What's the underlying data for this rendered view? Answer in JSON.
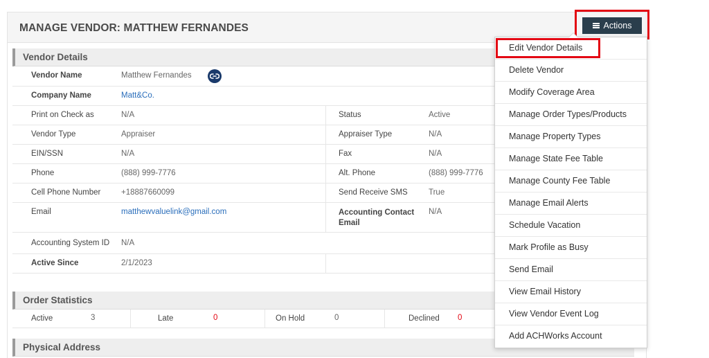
{
  "header": {
    "title": "MANAGE VENDOR: MATTHEW FERNANDES",
    "actions_label": "Actions"
  },
  "vendor_details": {
    "title": "Vendor Details",
    "rows": {
      "vendor_name": {
        "label": "Vendor Name",
        "value": "Matthew Fernandes"
      },
      "company_name": {
        "label": "Company Name",
        "value": "Matt&Co."
      },
      "print_on_check": {
        "label": "Print on Check as",
        "value": "N/A"
      },
      "status": {
        "label": "Status",
        "value": "Active"
      },
      "vendor_type": {
        "label": "Vendor Type",
        "value": "Appraiser"
      },
      "appraiser_type": {
        "label": "Appraiser Type",
        "value": "N/A"
      },
      "ein": {
        "label": "EIN/SSN",
        "value": "N/A"
      },
      "fax": {
        "label": "Fax",
        "value": "N/A"
      },
      "phone": {
        "label": "Phone",
        "value": "(888) 999-7776"
      },
      "alt_phone": {
        "label": "Alt. Phone",
        "value": "(888) 999-7776"
      },
      "cell": {
        "label": "Cell Phone Number",
        "value": "+18887660099"
      },
      "sms": {
        "label": "Send Receive SMS",
        "value": "True"
      },
      "email": {
        "label": "Email",
        "value": "matthewvaluelink@gmail.com"
      },
      "acct_email_l1": "Accounting Contact",
      "acct_email_l2": "Email",
      "acct_email_value": "N/A",
      "acct_system": {
        "label": "Accounting System ID",
        "value": "N/A"
      },
      "active_since": {
        "label": "Active Since",
        "value": "2/1/2023"
      }
    }
  },
  "order_statistics": {
    "title": "Order Statistics",
    "active": {
      "label": "Active",
      "value": "3"
    },
    "late": {
      "label": "Late",
      "value": "0"
    },
    "on_hold": {
      "label": "On Hold",
      "value": "0"
    },
    "declined": {
      "label": "Declined",
      "value": "0"
    }
  },
  "physical_address": {
    "title": "Physical Address"
  },
  "actions_menu": [
    "Edit Vendor Details",
    "Delete Vendor",
    "Modify Coverage Area",
    "Manage Order Types/Products",
    "Manage Property Types",
    "Manage State Fee Table",
    "Manage County Fee Table",
    "Manage Email Alerts",
    "Schedule Vacation",
    "Mark Profile as Busy",
    "Send Email",
    "View Email History",
    "View Vendor Event Log",
    "Add ACHWorks Account"
  ],
  "icons": {
    "vendor_badge": "link-icon",
    "actions_menu": "menu-icon"
  },
  "colors": {
    "accent": "#2a3e4c",
    "highlight": "#e30613",
    "link": "#2a6ebb"
  }
}
